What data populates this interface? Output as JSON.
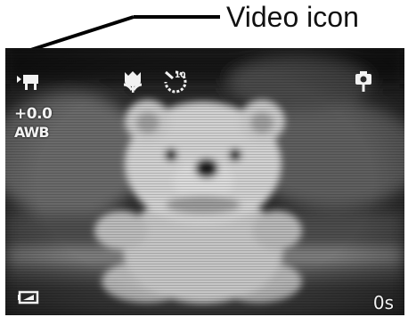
{
  "callout": {
    "label": "Video icon"
  },
  "viewfinder": {
    "icons": {
      "mode": "video-mode-icon",
      "macro": "macro-flower-icon",
      "self_timer": "self-timer-icon",
      "face_detect": "face-detect-icon",
      "battery": "battery-icon"
    },
    "exposure_compensation": "+0.0",
    "white_balance": "AWB",
    "self_timer_seconds": "10",
    "recording_time": "0s"
  }
}
